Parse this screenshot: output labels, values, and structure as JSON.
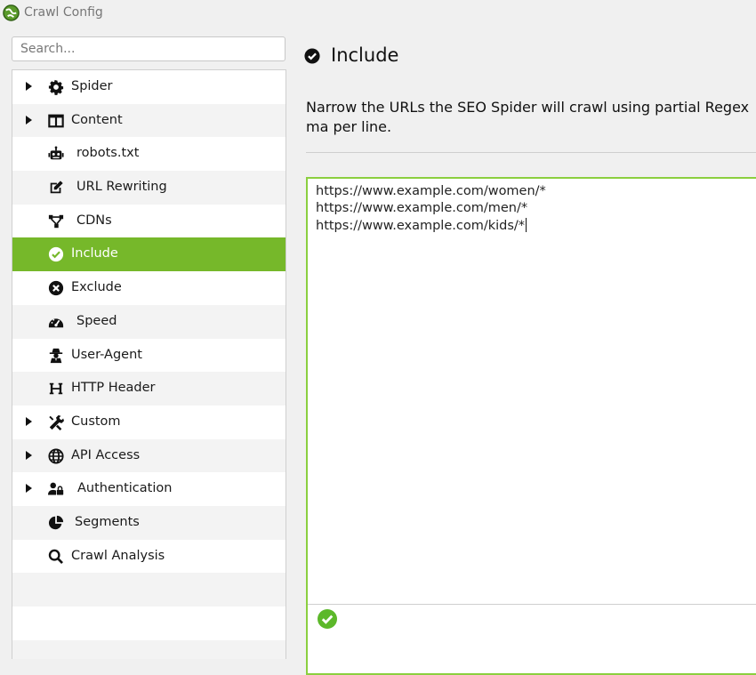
{
  "window": {
    "title": "Crawl Config",
    "icon": "app-globe-icon"
  },
  "search": {
    "placeholder": "Search..."
  },
  "sidebar": {
    "items": [
      {
        "label": "Spider",
        "icon": "gear-icon",
        "expandable": true
      },
      {
        "label": "Content",
        "icon": "columns-icon",
        "expandable": true
      },
      {
        "label": "robots.txt",
        "icon": "robot-icon",
        "expandable": false
      },
      {
        "label": "URL Rewriting",
        "icon": "edit-icon",
        "expandable": false
      },
      {
        "label": "CDNs",
        "icon": "network-icon",
        "expandable": false
      },
      {
        "label": "Include",
        "icon": "check-circle-icon",
        "expandable": false,
        "active": true
      },
      {
        "label": "Exclude",
        "icon": "x-circle-icon",
        "expandable": false
      },
      {
        "label": "Speed",
        "icon": "speedometer-icon",
        "expandable": false
      },
      {
        "label": "User-Agent",
        "icon": "user-secret-icon",
        "expandable": false
      },
      {
        "label": "HTTP Header",
        "icon": "heading-icon",
        "expandable": false
      },
      {
        "label": "Custom",
        "icon": "tools-icon",
        "expandable": true
      },
      {
        "label": "API Access",
        "icon": "globe-icon",
        "expandable": true
      },
      {
        "label": "Authentication",
        "icon": "user-lock-icon",
        "expandable": true
      },
      {
        "label": "Segments",
        "icon": "pie-chart-icon",
        "expandable": false
      },
      {
        "label": "Crawl Analysis",
        "icon": "search-icon",
        "expandable": false
      }
    ]
  },
  "main": {
    "title": "Include",
    "description": "Narrow the URLs the SEO Spider will crawl using partial Regex ma per line.",
    "editor": {
      "lines": [
        "https://www.example.com/women/*",
        "https://www.example.com/men/*",
        "https://www.example.com/kids/*"
      ],
      "status_icon": "valid-check-icon"
    }
  },
  "colors": {
    "accent": "#76b82a",
    "editor_border": "#8bcf3f"
  }
}
